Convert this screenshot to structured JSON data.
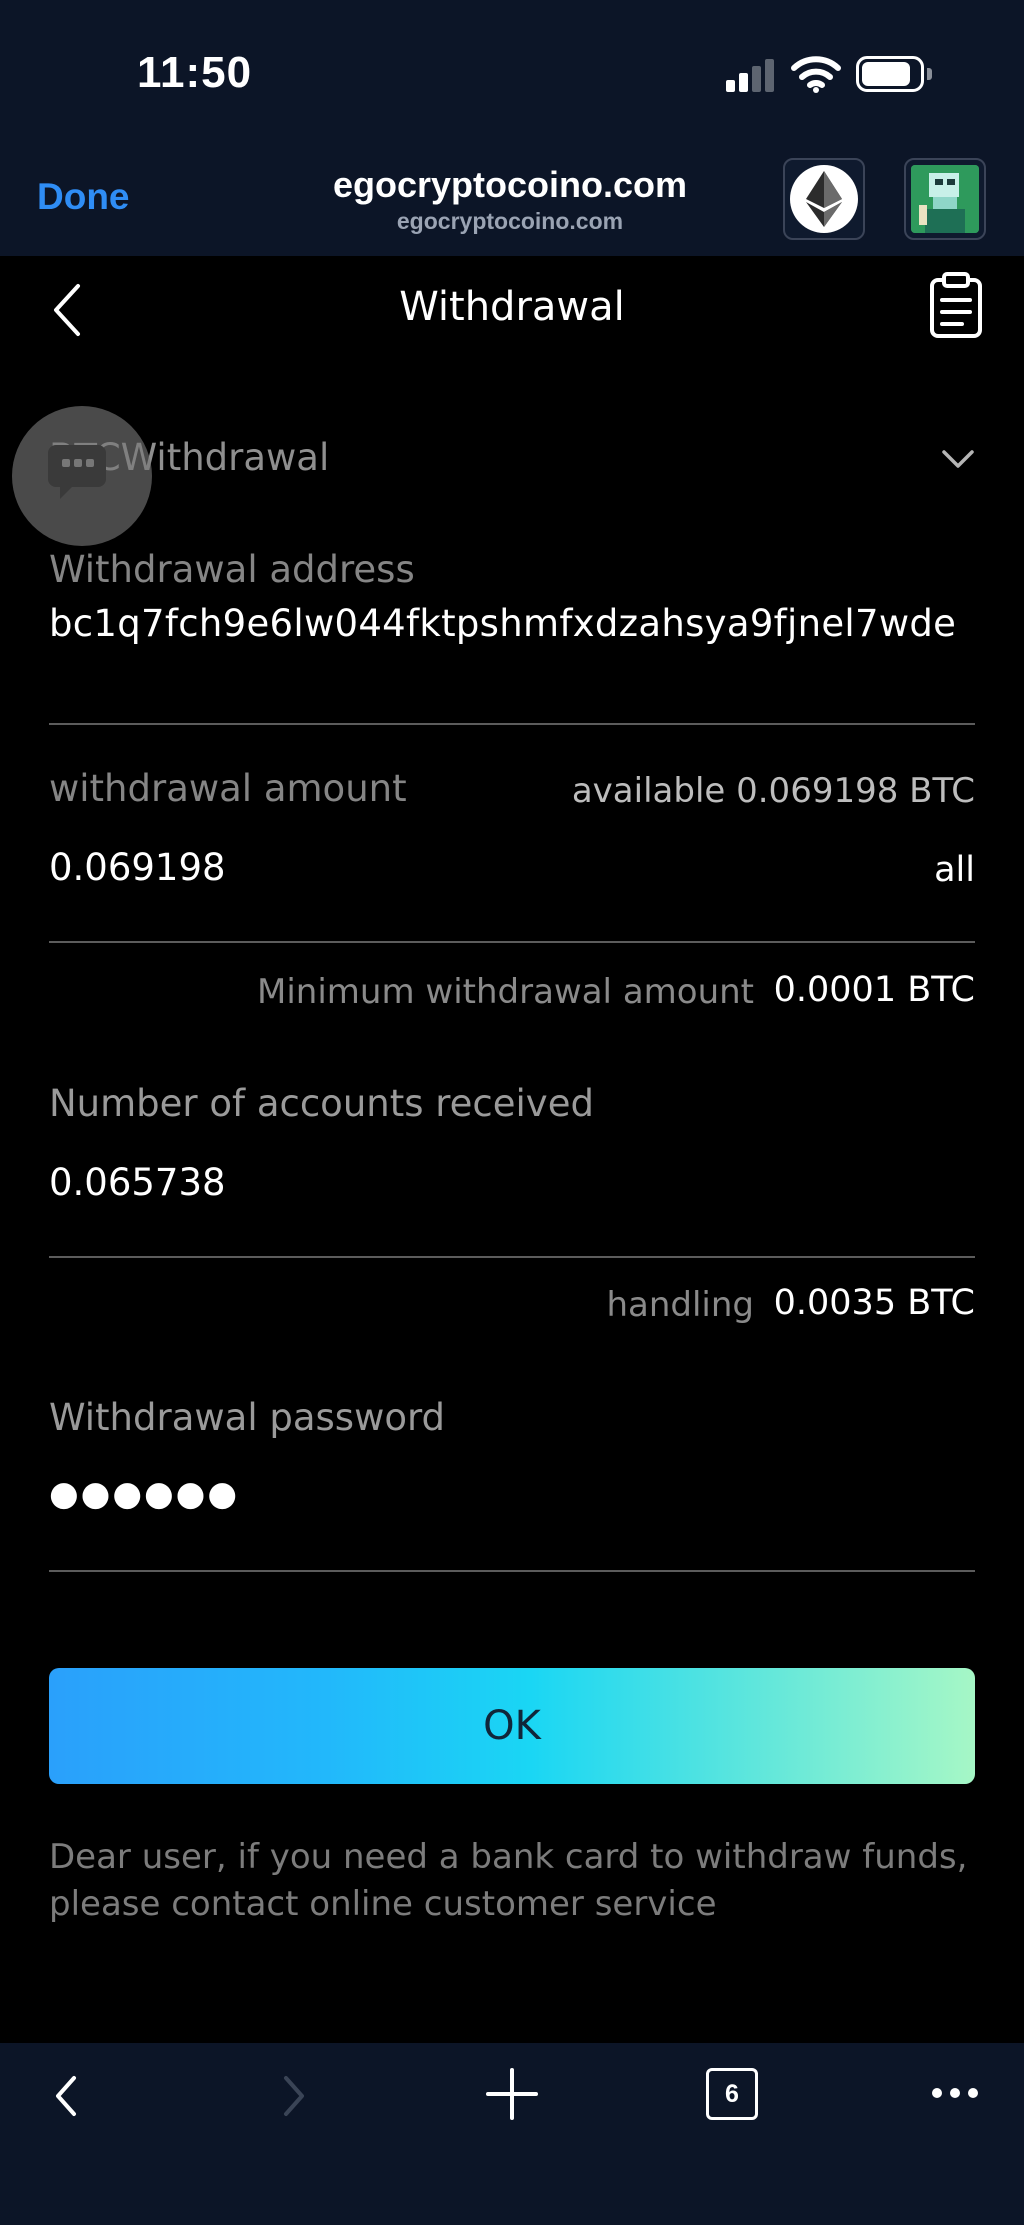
{
  "status_bar": {
    "time": "11:50"
  },
  "browser": {
    "done_label": "Done",
    "site_title": "egocryptocoino.com",
    "site_subtitle": "egocryptocoino.com",
    "tab_count": "6",
    "accent_color": "#2f8df5",
    "toolbar_color": "#0c1527"
  },
  "header": {
    "title": "Withdrawal"
  },
  "form": {
    "currency_select": "BTCWithdrawal",
    "address": {
      "label": "Withdrawal address",
      "value": "bc1q7fch9e6lw044fktpshmfxdzahsya9fjnel7wde"
    },
    "amount": {
      "label": "withdrawal amount",
      "available": "available 0.069198 BTC",
      "value": "0.069198",
      "all_label": "all"
    },
    "minimum": {
      "label": "Minimum withdrawal amount",
      "value": "0.0001 BTC"
    },
    "received": {
      "label": "Number of accounts received",
      "value": "0.065738"
    },
    "handling": {
      "label": "handling",
      "value": "0.0035 BTC"
    },
    "password": {
      "label": "Withdrawal password",
      "value": "●●●●●●"
    },
    "ok_label": "OK",
    "notice": "Dear user, if you need a bank card to withdraw funds, please contact online customer service"
  },
  "icons": {
    "chat": "chat-bubble-icon",
    "records": "clipboard-icon",
    "wallet_network": "ethereum-icon"
  }
}
